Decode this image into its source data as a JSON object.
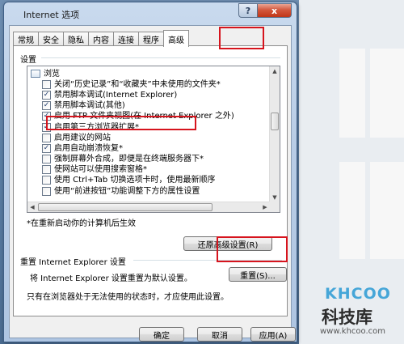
{
  "window": {
    "title": "Internet 选项",
    "help_glyph": "?",
    "close_glyph": "x"
  },
  "tabs": [
    {
      "label": "常规"
    },
    {
      "label": "安全"
    },
    {
      "label": "隐私"
    },
    {
      "label": "内容"
    },
    {
      "label": "连接"
    },
    {
      "label": "程序"
    },
    {
      "label": "高级",
      "selected": true
    }
  ],
  "settings": {
    "label": "设置",
    "group": "浏览",
    "items": [
      {
        "label": "关闭“历史记录”和“收藏夹”中未使用的文件夹*",
        "checked": false
      },
      {
        "label": "禁用脚本调试(Internet Explorer)",
        "checked": true
      },
      {
        "label": "禁用脚本调试(其他)",
        "checked": true
      },
      {
        "label": "启用 FTP 文件夹视图(在 Internet Explorer 之外)",
        "checked": true
      },
      {
        "label": "启用第三方浏览器扩展*",
        "checked": true
      },
      {
        "label": "启用建议的网站",
        "checked": false
      },
      {
        "label": "启用自动崩溃恢复*",
        "checked": true
      },
      {
        "label": "强制屏幕外合成，即便是在终端服务器下*",
        "checked": false
      },
      {
        "label": "使网站可以使用搜索窗格*",
        "checked": false
      },
      {
        "label": "使用 Ctrl+Tab 切换选项卡时，使用最新顺序",
        "checked": false
      },
      {
        "label": "使用“前进按钮”功能调整下方的属性设置",
        "checked": false
      }
    ],
    "check_glyph": "✓",
    "restart_note": "*在重新启动你的计算机后生效",
    "restore_button": "还原高级设置(R)"
  },
  "reset_group": {
    "title": "重置 Internet Explorer 设置",
    "description": "将 Internet Explorer 设置重置为默认设置。",
    "reset_button": "重置(S)...",
    "note": "只有在浏览器处于无法使用的状态时，才应使用此设置。"
  },
  "footer": {
    "ok": "确定",
    "cancel": "取消",
    "apply": "应用(A)"
  },
  "watermark": {
    "logo": "KHCOO",
    "name": "科技库",
    "url": "www.khcoo.com"
  },
  "colors": {
    "annotation_red": "#d6141d",
    "watermark_accent": "#46a6d8"
  }
}
